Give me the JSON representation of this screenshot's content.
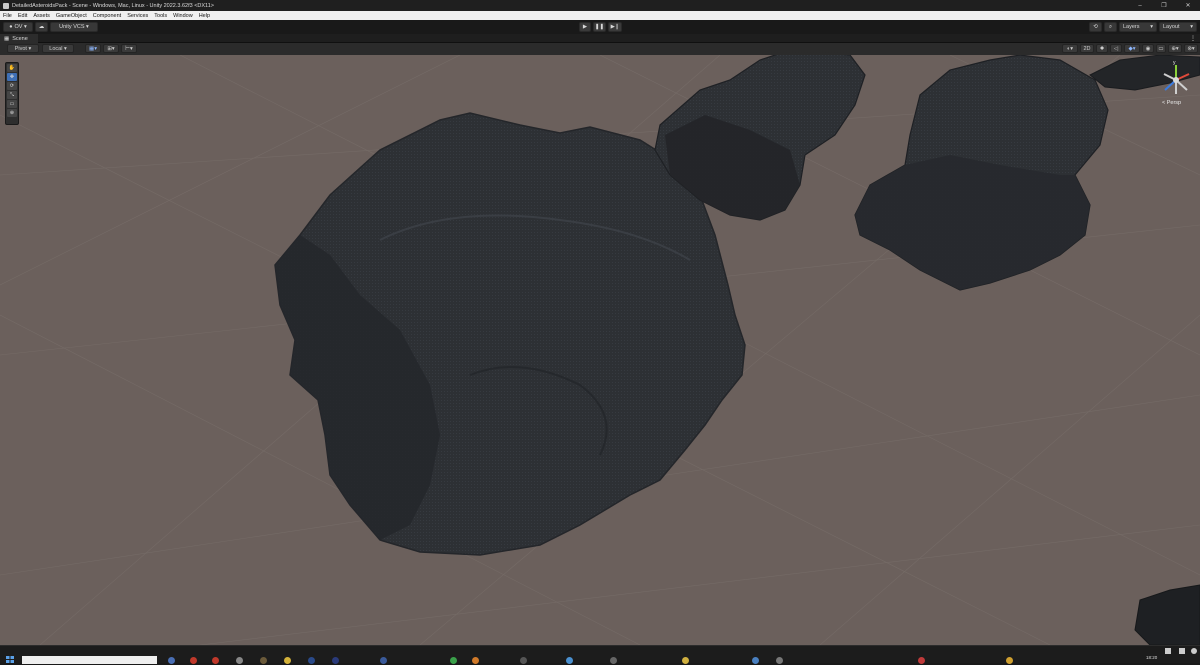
{
  "window": {
    "title": "DetailedAsteroidsPack - Scene - Windows, Mac, Linux - Unity 2022.3.62f3 <DX11>",
    "controls": [
      "–",
      "❐",
      "✕"
    ]
  },
  "menu": [
    "File",
    "Edit",
    "Assets",
    "GameObject",
    "Component",
    "Services",
    "Tools",
    "Window",
    "Help"
  ],
  "toolbar": {
    "account": "OV ▾",
    "vcs": "Unity VCS ▾",
    "play_icon": "▶",
    "pause_icon": "❚❚",
    "step_icon": "▶❙",
    "layers": "Layers",
    "layout": "Layout"
  },
  "scene_tab": {
    "label": "Scene"
  },
  "scene_toolbar": {
    "pivot": "Pivot ▾",
    "local": "Local ▾",
    "mode_2d": "2D"
  },
  "gizmo": {
    "y_axis": "y",
    "projection": "< Persp"
  },
  "taskbar": {
    "time": "18:20"
  },
  "colors": {
    "viewport_bg": "#6b605c",
    "asteroid": "#2d2f33",
    "accent": "#3e6fb5"
  }
}
